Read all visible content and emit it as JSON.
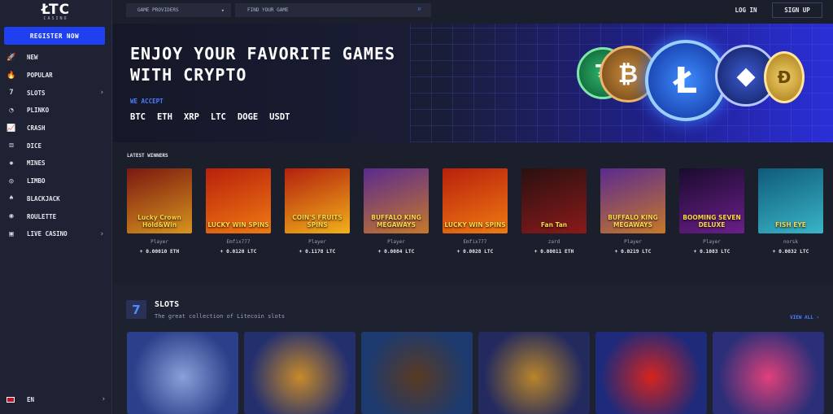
{
  "logo": {
    "main": "ŁTC",
    "sub": "CASINO"
  },
  "sidebar": {
    "register_label": "REGISTER NOW",
    "items": [
      {
        "label": "NEW",
        "icon": "rocket-icon",
        "glyph": "🚀",
        "chevron": false
      },
      {
        "label": "POPULAR",
        "icon": "flame-icon",
        "glyph": "🔥",
        "chevron": false
      },
      {
        "label": "SLOTS",
        "icon": "slots-icon",
        "glyph": "7",
        "chevron": true
      },
      {
        "label": "PLINKO",
        "icon": "plinko-icon",
        "glyph": "◔",
        "chevron": false
      },
      {
        "label": "CRASH",
        "icon": "crash-icon",
        "glyph": "📈",
        "chevron": false
      },
      {
        "label": "DICE",
        "icon": "dice-icon",
        "glyph": "⚄",
        "chevron": false
      },
      {
        "label": "MINES",
        "icon": "mines-icon",
        "glyph": "✸",
        "chevron": false
      },
      {
        "label": "LIMBO",
        "icon": "limbo-icon",
        "glyph": "◎",
        "chevron": false
      },
      {
        "label": "BLACKJACK",
        "icon": "cards-icon",
        "glyph": "♠",
        "chevron": false
      },
      {
        "label": "ROULETTE",
        "icon": "roulette-icon",
        "glyph": "◉",
        "chevron": false
      },
      {
        "label": "LIVE CASINO",
        "icon": "live-casino-icon",
        "glyph": "▣",
        "chevron": true
      }
    ],
    "language": "EN"
  },
  "topbar": {
    "providers_placeholder": "GAME PROVIDERS",
    "search_placeholder": "FIND YOUR GAME",
    "login_label": "LOG IN",
    "signup_label": "SIGN UP"
  },
  "banner": {
    "title_line1": "ENJOY YOUR FAVORITE GAMES",
    "title_line2": "WITH CRYPTO",
    "accept_label": "WE ACCEPT",
    "cryptos": [
      "BTC",
      "ETH",
      "XRP",
      "LTC",
      "DOGE",
      "USDT"
    ]
  },
  "latest_winners": {
    "label": "LATEST WINNERS",
    "items": [
      {
        "game": "Lucky Crown Hold&Win",
        "player": "Player",
        "amount": "+ 0.00010 ETH",
        "color1": "#7a1810",
        "color2": "#d7941e"
      },
      {
        "game": "LUCKY WIN SPINS",
        "player": "Emfix777",
        "amount": "+ 0.0120 LTC",
        "color1": "#b8200c",
        "color2": "#f07a12"
      },
      {
        "game": "COIN'S FRUITS SPINS",
        "player": "Player",
        "amount": "+ 0.1178 LTC",
        "color1": "#b3200e",
        "color2": "#f2b11a"
      },
      {
        "game": "BUFFALO KING MEGAWAYS",
        "player": "Player",
        "amount": "+ 0.0084 LTC",
        "color1": "#5a2a8f",
        "color2": "#c7782a"
      },
      {
        "game": "LUCKY WIN SPINS",
        "player": "Emfix777",
        "amount": "+ 0.0028 LTC",
        "color1": "#b8200c",
        "color2": "#f07a12"
      },
      {
        "game": "Fan Tan",
        "player": "zard",
        "amount": "+ 0.00011 ETH",
        "color1": "#2a1010",
        "color2": "#8a1a1a"
      },
      {
        "game": "BUFFALO KING MEGAWAYS",
        "player": "Player",
        "amount": "+ 0.0219 LTC",
        "color1": "#5a2a8f",
        "color2": "#c7782a"
      },
      {
        "game": "BOOMING SEVEN DELUXE",
        "player": "Player",
        "amount": "+ 0.1083 LTC",
        "color1": "#1a0b2e",
        "color2": "#6b1f8a"
      },
      {
        "game": "FISH EYE",
        "player": "norsk",
        "amount": "+ 0.0032 LTC",
        "color1": "#0f5a7a",
        "color2": "#39b5c7"
      }
    ]
  },
  "slots_section": {
    "title": "SLOTS",
    "subtitle": "The great collection of Litecoin slots",
    "view_all": "VIEW ALL ›",
    "games": [
      {
        "name": "zeus-game",
        "color1": "#2b3f8a",
        "color2": "#8aa0d8"
      },
      {
        "name": "pegasus-game",
        "color1": "#24306e",
        "color2": "#c78a2a"
      },
      {
        "name": "dog-game",
        "color1": "#1d3a6e",
        "color2": "#5a3a22"
      },
      {
        "name": "book-game",
        "color1": "#232a5e",
        "color2": "#b9852a"
      },
      {
        "name": "fruit-seven-game",
        "color1": "#1e2a7a",
        "color2": "#d6241f"
      },
      {
        "name": "candy-bomb-game",
        "color1": "#2a2f78",
        "color2": "#e0407a"
      }
    ]
  }
}
